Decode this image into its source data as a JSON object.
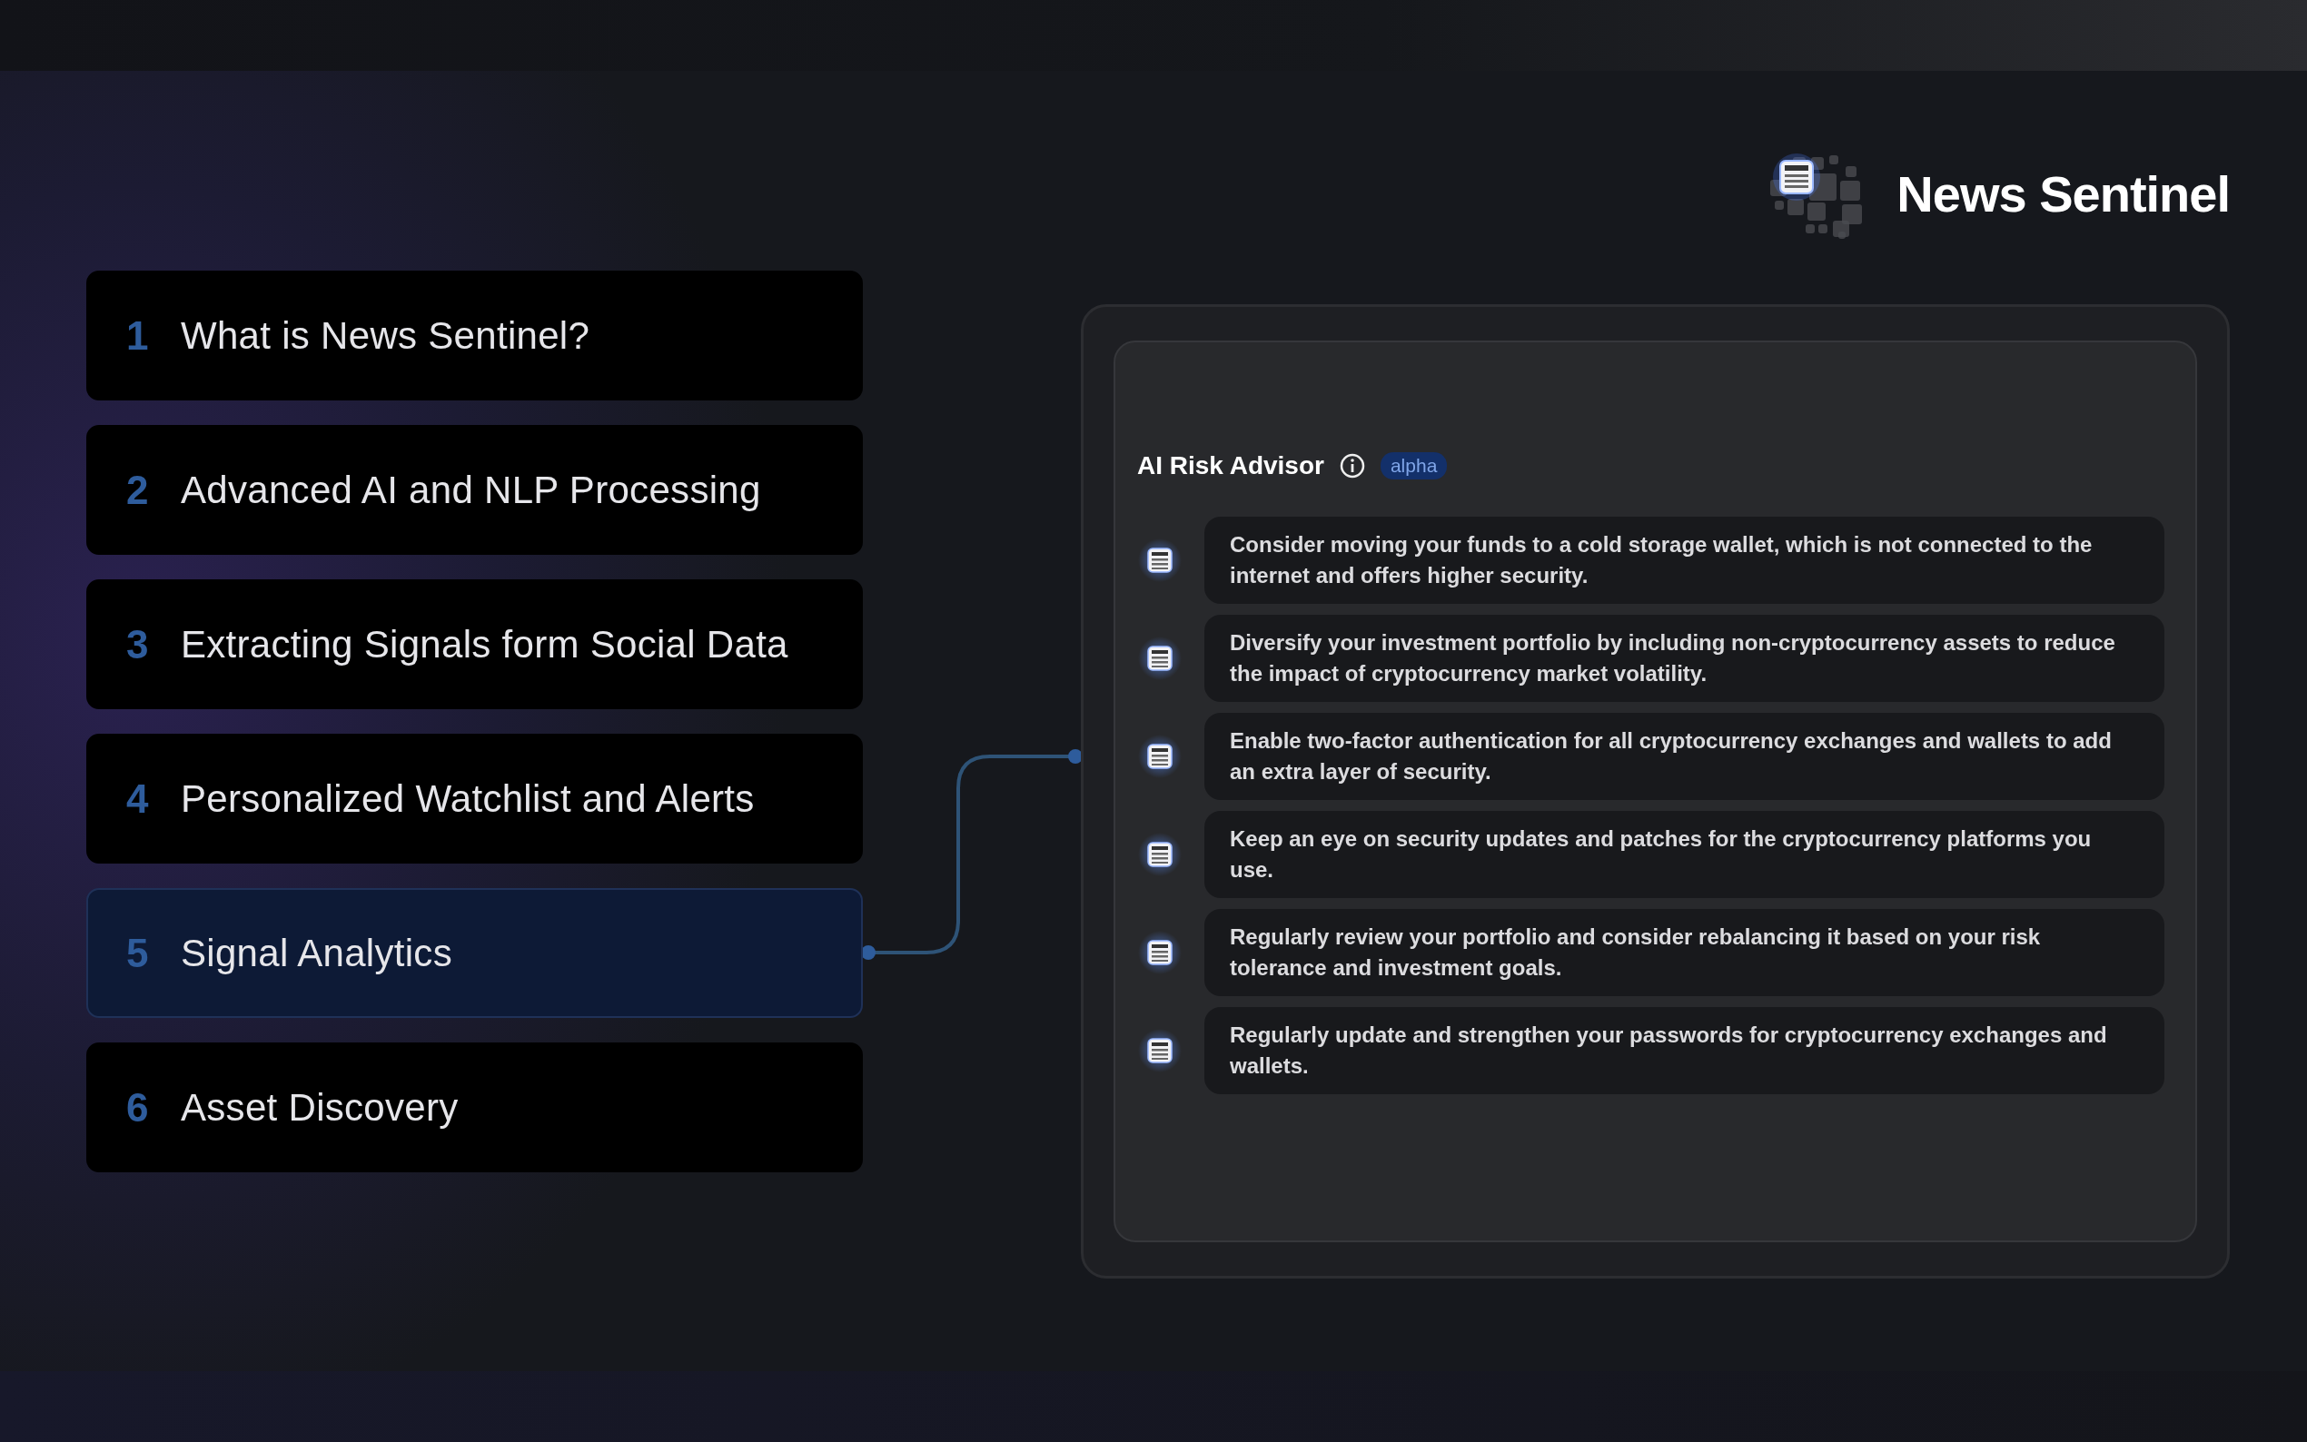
{
  "brand": {
    "name": "News Sentinel"
  },
  "menu": [
    {
      "number": "1",
      "label": "What is News Sentinel?",
      "selected": false
    },
    {
      "number": "2",
      "label": "Advanced AI and NLP Processing",
      "selected": false
    },
    {
      "number": "3",
      "label": "Extracting Signals form Social Data",
      "selected": false
    },
    {
      "number": "4",
      "label": "Personalized Watchlist and Alerts",
      "selected": false
    },
    {
      "number": "5",
      "label": "Signal Analytics",
      "selected": true
    },
    {
      "number": "6",
      "label": "Asset Discovery",
      "selected": false
    }
  ],
  "advisor": {
    "title": "AI Risk Advisor",
    "badge": "alpha",
    "items": [
      "Consider moving your funds to a cold storage wallet, which is not connected to the internet and offers higher security.",
      "Diversify your investment portfolio by including non-cryptocurrency assets to reduce the impact of cryptocurrency market volatility.",
      "Enable two-factor authentication for all cryptocurrency exchanges and wallets to add an extra layer of security.",
      "Keep an eye on security updates and patches for the cryptocurrency platforms you use.",
      "Regularly review your portfolio and consider rebalancing it based on your risk tolerance and investment goals.",
      "Regularly update and strengthen your passwords for cryptocurrency exchanges and wallets."
    ]
  }
}
